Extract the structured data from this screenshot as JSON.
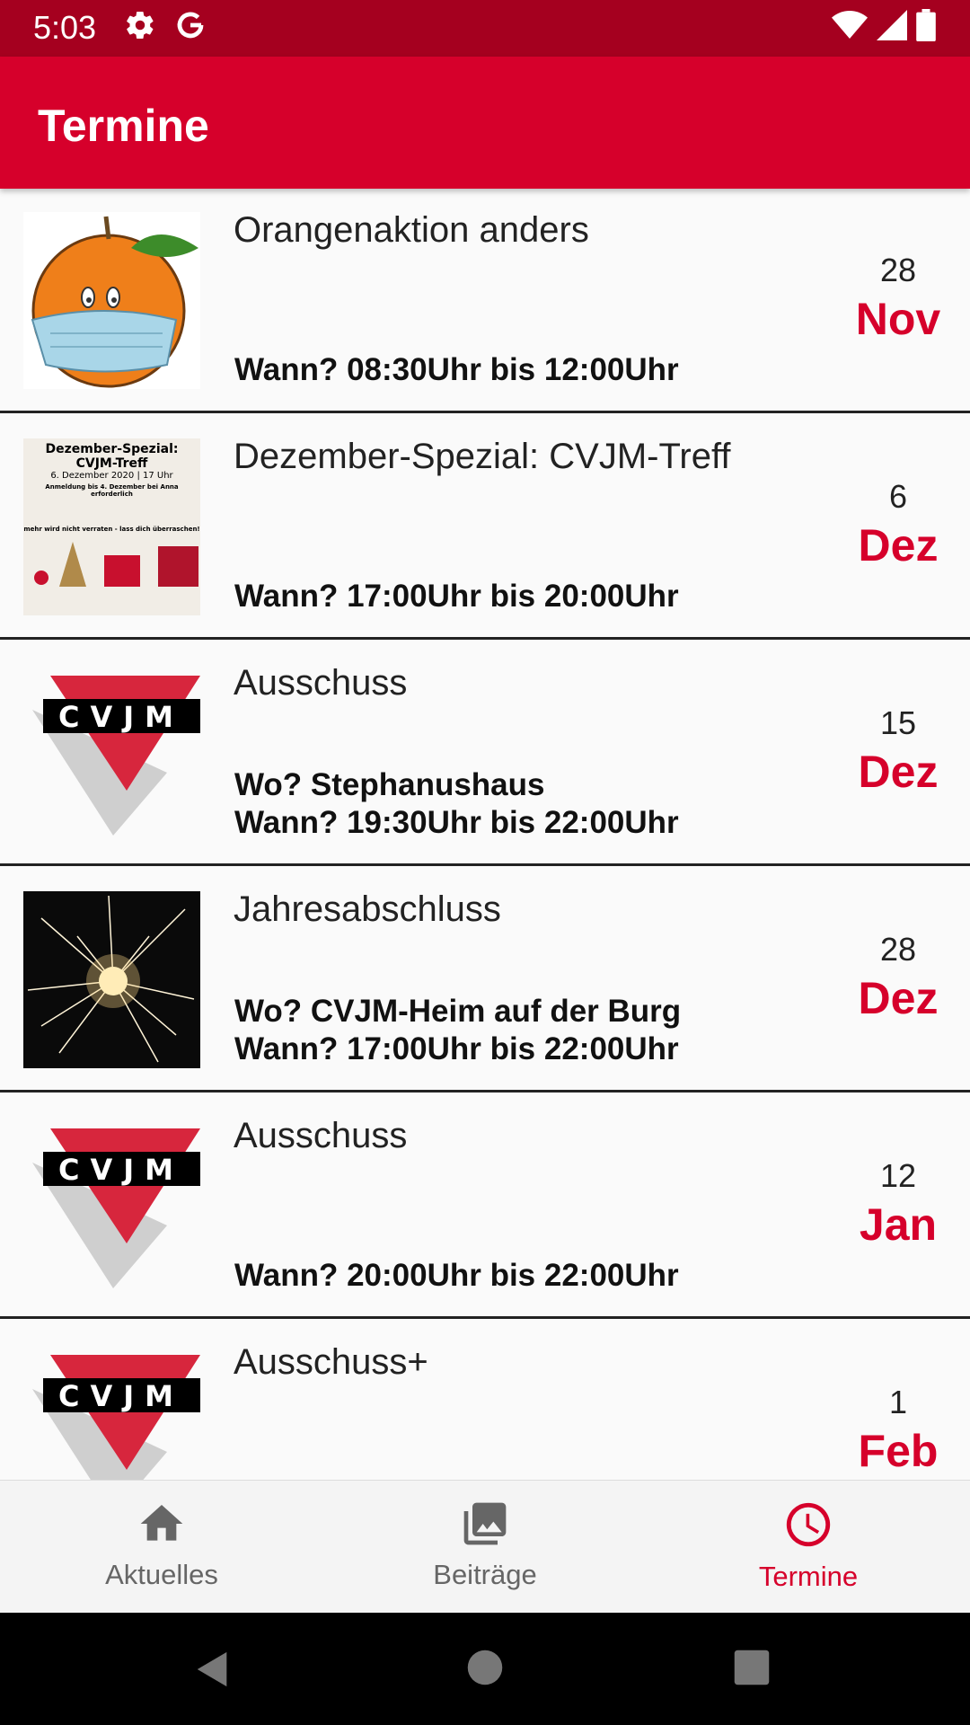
{
  "status_bar": {
    "time": "5:03"
  },
  "app_bar": {
    "title": "Termine"
  },
  "events": [
    {
      "title": "Orangenaktion anders",
      "where": "",
      "when": "Wann? 08:30Uhr bis 12:00Uhr",
      "day": "28",
      "month": "Nov",
      "thumb": "orange-mask-icon"
    },
    {
      "title": "Dezember-Spezial: CVJM-Treff",
      "where": "",
      "when": "Wann? 17:00Uhr bis 20:00Uhr",
      "day": "6",
      "month": "Dez",
      "thumb": "flyer-image",
      "flyer": {
        "heading1": "Dezember-Spezial:",
        "heading2": "CVJM-Treff",
        "date": "6. Dezember 2020 | 17 Uhr",
        "note": "Anmeldung bis 4. Dezember bei Anna erforderlich",
        "footer": "mehr wird nicht verraten - lass dich überraschen!"
      }
    },
    {
      "title": "Ausschuss",
      "where": "Wo? Stephanushaus",
      "when": "Wann? 19:30Uhr bis 22:00Uhr",
      "day": "15",
      "month": "Dez",
      "thumb": "cvjm-logo"
    },
    {
      "title": "Jahresabschluss",
      "where": "Wo? CVJM-Heim auf der Burg",
      "when": "Wann? 17:00Uhr bis 22:00Uhr",
      "day": "28",
      "month": "Dez",
      "thumb": "sparkler-image"
    },
    {
      "title": "Ausschuss",
      "where": "",
      "when": "Wann? 20:00Uhr bis 22:00Uhr",
      "day": "12",
      "month": "Jan",
      "thumb": "cvjm-logo"
    },
    {
      "title": "Ausschuss+",
      "where": "",
      "when": "",
      "day": "1",
      "month": "Feb",
      "thumb": "cvjm-logo"
    }
  ],
  "logo_text": "CVJM",
  "bottom_nav": {
    "items": [
      {
        "label": "Aktuelles",
        "icon": "home-icon",
        "active": false
      },
      {
        "label": "Beiträge",
        "icon": "photo-library-icon",
        "active": false
      },
      {
        "label": "Termine",
        "icon": "clock-icon",
        "active": true
      }
    ]
  },
  "colors": {
    "primary": "#d6002b",
    "status_bar": "#a5001f",
    "inactive": "#666666"
  }
}
